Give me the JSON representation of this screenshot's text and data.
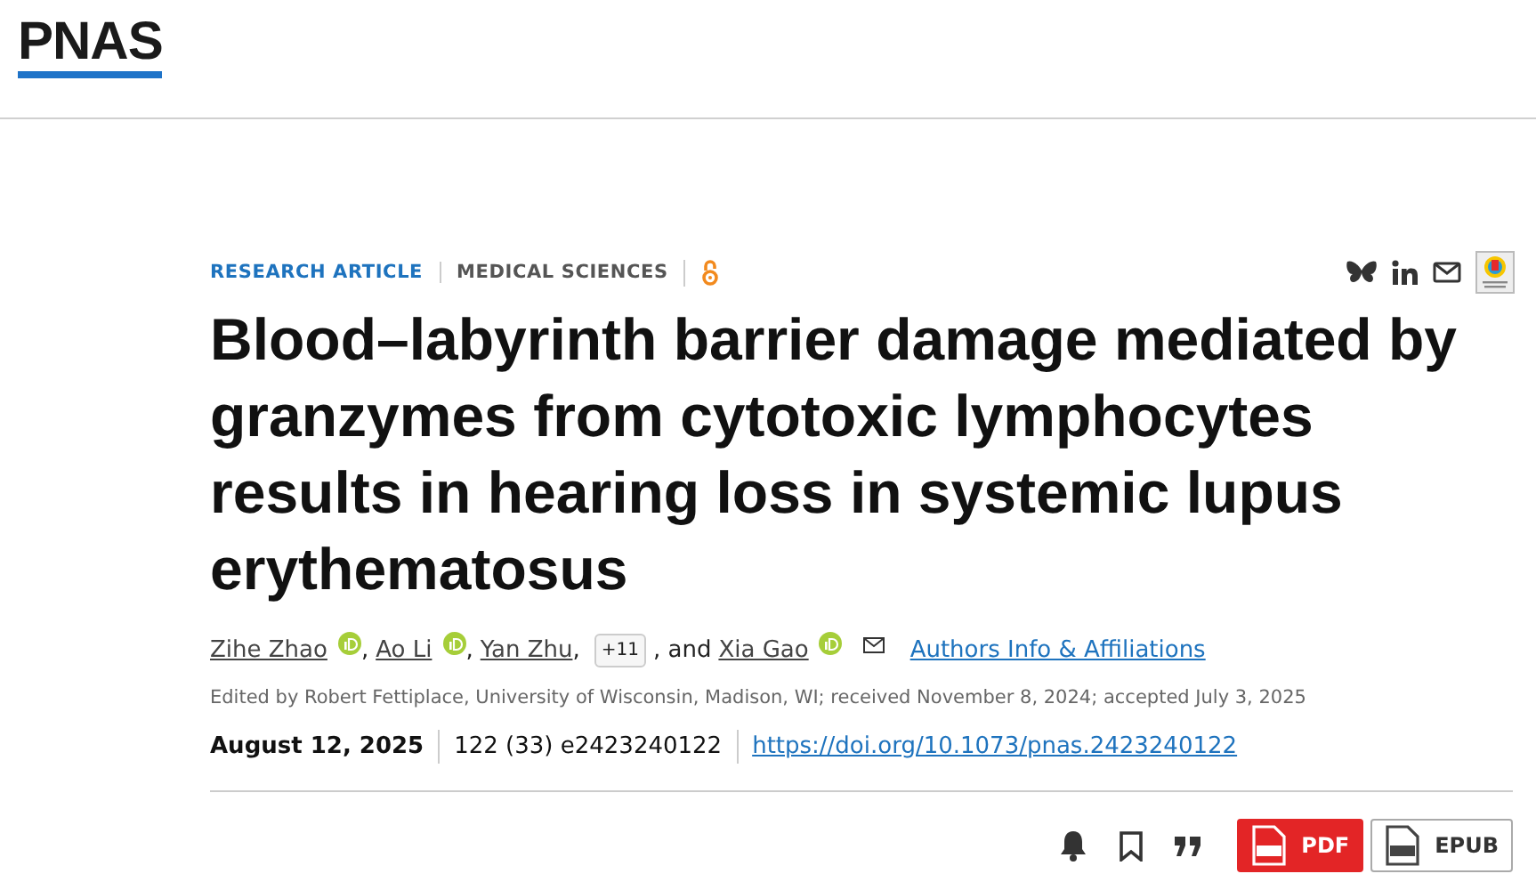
{
  "logo": "PNAS",
  "article_type": "RESEARCH ARTICLE",
  "section": "MEDICAL SCIENCES",
  "open_access": true,
  "title": "Blood–labyrinth barrier damage mediated by granzymes from cytotoxic lymphocytes results in hearing loss in systemic lupus erythematosus",
  "authors": [
    {
      "name": "Zihe Zhao",
      "orcid": true,
      "sep": ","
    },
    {
      "name": "Ao Li",
      "orcid": true,
      "sep": ","
    },
    {
      "name": "Yan Zhu",
      "orcid": false,
      "sep": ","
    }
  ],
  "more_authors": "+11",
  "last_author_prefix": ", and",
  "last_author": {
    "name": "Xia Gao",
    "orcid": true
  },
  "affiliations_link": "Authors Info & Affiliations",
  "edited": "Edited by Robert Fettiplace, University of Wisconsin, Madison, WI; received November 8, 2024; accepted July 3, 2025",
  "date": "August 12, 2025",
  "citation": "122 (33) e2423240122",
  "doi": "https://doi.org/10.1073/pnas.2423240122",
  "downloads": [
    {
      "label": "PDF",
      "kind": "pdf"
    },
    {
      "label": "EPUB",
      "kind": "epub"
    }
  ]
}
